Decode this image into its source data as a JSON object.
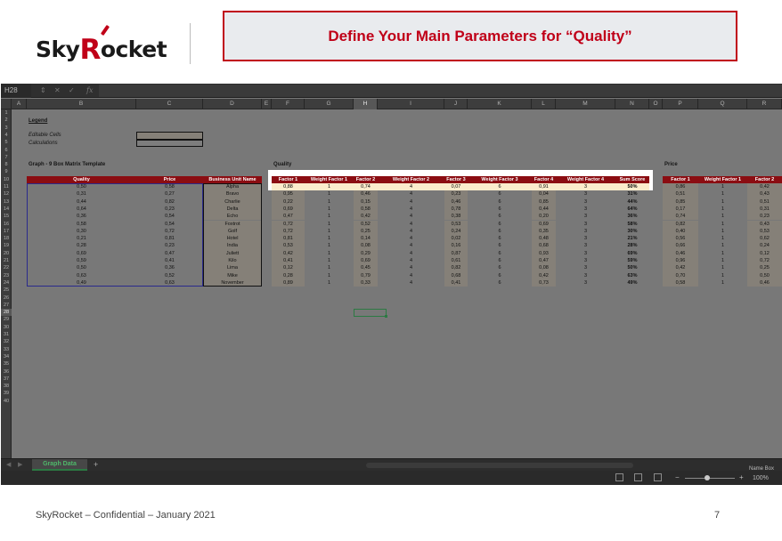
{
  "slide": {
    "logo_prefix": "Sky",
    "logo_r": "R",
    "logo_suffix": "ocket",
    "title": "Define Your Main Parameters for “Quality”",
    "footer": "SkyRocket – Confidential – January 2021",
    "page_number": "7"
  },
  "excel": {
    "name_box": "H28",
    "formula_fx": "fx",
    "columns": [
      "A",
      "B",
      "C",
      "D",
      "E",
      "F",
      "G",
      "H",
      "I",
      "J",
      "K",
      "L",
      "M",
      "N",
      "O",
      "P",
      "Q",
      "R"
    ],
    "selected_column": "H",
    "rows": [
      "1",
      "2",
      "3",
      "4",
      "5",
      "6",
      "7",
      "8",
      "9",
      "10",
      "11",
      "12",
      "13",
      "14",
      "15",
      "16",
      "17",
      "18",
      "19",
      "20",
      "21",
      "22",
      "23",
      "24",
      "25",
      "26",
      "27",
      "28",
      "29",
      "30",
      "31",
      "32",
      "33",
      "34",
      "35",
      "36",
      "37",
      "38",
      "39",
      "40"
    ],
    "selected_row": "28",
    "sheet_tab": "Graph Data",
    "add_sheet": "+",
    "status_name_label": "Name Box",
    "zoom": "100%",
    "zoom_minus": "−",
    "zoom_plus": "+",
    "accent_green": "#2c7a43",
    "header_red": "#8b0d12"
  },
  "sheet": {
    "legend": "Legend",
    "editable_cells": "Editable Cells",
    "calculations": "Calculations",
    "graph_title": "Graph - 9 Box Matrix Template",
    "quality_label": "Quality",
    "price_label": "Price",
    "left_headers": [
      "Quality",
      "Price",
      "Business Unit Name"
    ],
    "left_rows": [
      [
        "0,50",
        "0,58",
        "Alpha"
      ],
      [
        "0,31",
        "0,27",
        "Bravo"
      ],
      [
        "0,44",
        "0,82",
        "Charlie"
      ],
      [
        "0,64",
        "0,23",
        "Delta"
      ],
      [
        "0,36",
        "0,54",
        "Echo"
      ],
      [
        "0,58",
        "0,54",
        "Foxtrot"
      ],
      [
        "0,30",
        "0,72",
        "Golf"
      ],
      [
        "0,21",
        "0,81",
        "Hotel"
      ],
      [
        "0,28",
        "0,23",
        "India"
      ],
      [
        "0,69",
        "0,47",
        "Juliett"
      ],
      [
        "0,59",
        "0,41",
        "Kilo"
      ],
      [
        "0,50",
        "0,36",
        "Lima"
      ],
      [
        "0,63",
        "0,52",
        "Mike"
      ],
      [
        "0,49",
        "0,63",
        "November"
      ]
    ],
    "quality_headers": [
      "Factor 1",
      "Weight Factor 1",
      "Factor 2",
      "Weight Factor 2",
      "Factor 3",
      "Weight Factor 3",
      "Factor 4",
      "Weight Factor 4",
      "Sum Score"
    ],
    "quality_rows": [
      [
        "0,88",
        "1",
        "0,74",
        "4",
        "0,07",
        "6",
        "0,91",
        "3",
        "50%"
      ],
      [
        "0,95",
        "1",
        "0,46",
        "4",
        "0,23",
        "6",
        "0,04",
        "3",
        "31%"
      ],
      [
        "0,22",
        "1",
        "0,15",
        "4",
        "0,46",
        "6",
        "0,85",
        "3",
        "44%"
      ],
      [
        "0,69",
        "1",
        "0,58",
        "4",
        "0,78",
        "6",
        "0,44",
        "3",
        "64%"
      ],
      [
        "0,47",
        "1",
        "0,42",
        "4",
        "0,38",
        "6",
        "0,20",
        "3",
        "36%"
      ],
      [
        "0,72",
        "1",
        "0,52",
        "4",
        "0,53",
        "6",
        "0,69",
        "3",
        "58%"
      ],
      [
        "0,72",
        "1",
        "0,25",
        "4",
        "0,24",
        "6",
        "0,35",
        "3",
        "30%"
      ],
      [
        "0,81",
        "1",
        "0,14",
        "4",
        "0,02",
        "6",
        "0,48",
        "3",
        "21%"
      ],
      [
        "0,53",
        "1",
        "0,08",
        "4",
        "0,16",
        "6",
        "0,68",
        "3",
        "28%"
      ],
      [
        "0,42",
        "1",
        "0,29",
        "4",
        "0,87",
        "6",
        "0,93",
        "3",
        "69%"
      ],
      [
        "0,41",
        "1",
        "0,69",
        "4",
        "0,61",
        "6",
        "0,47",
        "3",
        "59%"
      ],
      [
        "0,12",
        "1",
        "0,45",
        "4",
        "0,82",
        "6",
        "0,08",
        "3",
        "50%"
      ],
      [
        "0,28",
        "1",
        "0,79",
        "4",
        "0,68",
        "6",
        "0,42",
        "3",
        "63%"
      ],
      [
        "0,89",
        "1",
        "0,33",
        "4",
        "0,41",
        "6",
        "0,73",
        "3",
        "49%"
      ]
    ],
    "price_headers": [
      "Factor 1",
      "Weight Factor 1",
      "Factor 2"
    ],
    "price_rows": [
      [
        "0,86",
        "1",
        "0,42"
      ],
      [
        "0,51",
        "1",
        "0,43"
      ],
      [
        "0,85",
        "1",
        "0,51"
      ],
      [
        "0,17",
        "1",
        "0,31"
      ],
      [
        "0,74",
        "1",
        "0,23"
      ],
      [
        "0,82",
        "1",
        "0,43"
      ],
      [
        "0,40",
        "1",
        "0,53"
      ],
      [
        "0,56",
        "1",
        "0,62"
      ],
      [
        "0,66",
        "1",
        "0,24"
      ],
      [
        "0,46",
        "1",
        "0,12"
      ],
      [
        "0,96",
        "1",
        "0,72"
      ],
      [
        "0,42",
        "1",
        "0,25"
      ],
      [
        "0,70",
        "1",
        "0,50"
      ],
      [
        "0,58",
        "1",
        "0,46"
      ]
    ]
  }
}
